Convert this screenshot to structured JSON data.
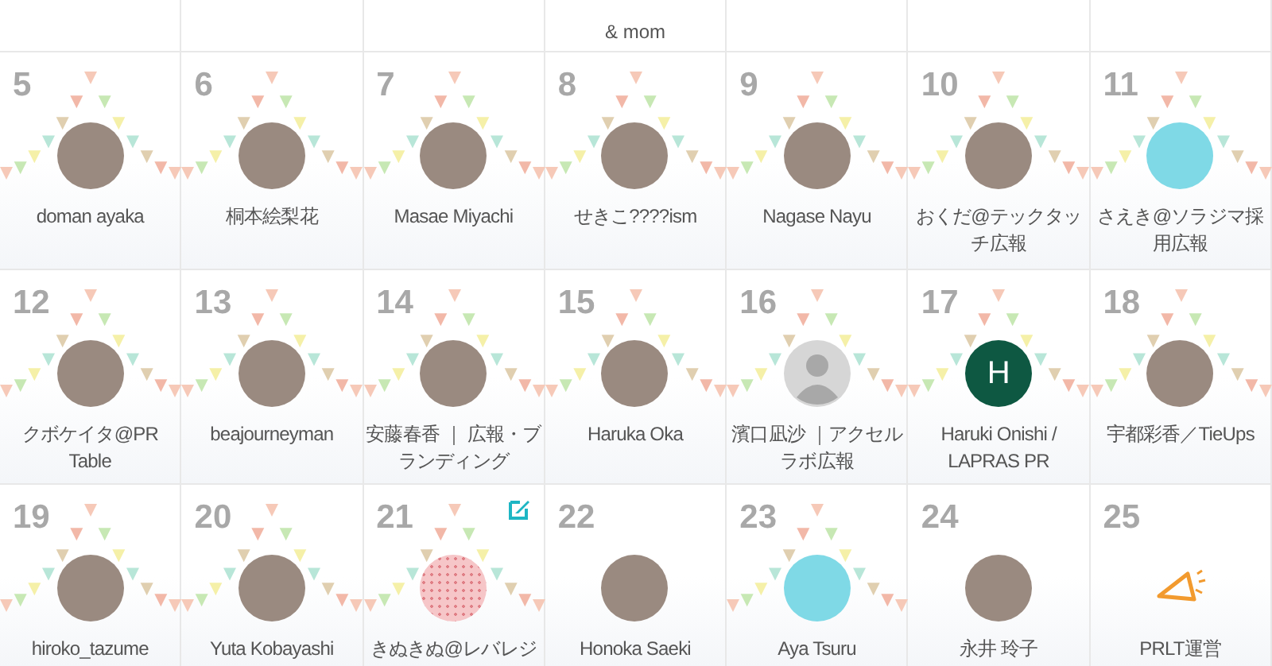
{
  "top_row": [
    {
      "kind": "blank"
    },
    {
      "kind": "blank"
    },
    {
      "kind": "blank"
    },
    {
      "kind": "name",
      "name": "& mom"
    },
    {
      "kind": "blank"
    },
    {
      "kind": "blank"
    },
    {
      "kind": "blank"
    }
  ],
  "days": [
    {
      "day": "5",
      "name": "doman ayaka",
      "kind": "photo",
      "decorated": true,
      "editable": false
    },
    {
      "day": "6",
      "name": "桐本絵梨花",
      "kind": "photo",
      "decorated": true,
      "editable": false
    },
    {
      "day": "7",
      "name": "Masae Miyachi",
      "kind": "photo",
      "decorated": true,
      "editable": false
    },
    {
      "day": "8",
      "name": "せきこ????ism",
      "kind": "photo",
      "decorated": true,
      "editable": false
    },
    {
      "day": "9",
      "name": "Nagase Nayu",
      "kind": "photo",
      "decorated": true,
      "editable": false
    },
    {
      "day": "10",
      "name": "おくだ@テックタッチ広報",
      "kind": "photo",
      "decorated": true,
      "editable": false
    },
    {
      "day": "11",
      "name": "さえき@ソラジマ採用広報",
      "kind": "illustration",
      "decorated": true,
      "editable": false
    },
    {
      "day": "12",
      "name": "クボケイタ@PR Table",
      "kind": "photo",
      "decorated": true,
      "editable": false
    },
    {
      "day": "13",
      "name": "beajourneyman",
      "kind": "photo",
      "decorated": true,
      "editable": false
    },
    {
      "day": "14",
      "name": "安藤春香 ｜ 広報・ブランディング",
      "kind": "photo",
      "decorated": true,
      "editable": false
    },
    {
      "day": "15",
      "name": "Haruka Oka",
      "kind": "photo",
      "decorated": true,
      "editable": false
    },
    {
      "day": "16",
      "name": "濱口凪沙 ｜アクセルラボ広報",
      "kind": "default",
      "decorated": true,
      "editable": false
    },
    {
      "day": "17",
      "name": "Haruki Onishi / LAPRAS PR",
      "kind": "initial",
      "initial": "H",
      "decorated": true,
      "editable": false
    },
    {
      "day": "18",
      "name": "宇都彩香／TieUps",
      "kind": "photo",
      "decorated": true,
      "editable": false
    },
    {
      "day": "19",
      "name": "hiroko_tazume",
      "kind": "photo",
      "decorated": true,
      "editable": false
    },
    {
      "day": "20",
      "name": "Yuta Kobayashi",
      "kind": "photo",
      "decorated": true,
      "editable": false
    },
    {
      "day": "21",
      "name": "きぬきぬ@レバレジ",
      "kind": "pattern",
      "decorated": true,
      "editable": true
    },
    {
      "day": "22",
      "name": "Honoka Saeki",
      "kind": "photo",
      "decorated": false,
      "editable": false
    },
    {
      "day": "23",
      "name": "Aya Tsuru",
      "kind": "illustration",
      "decorated": true,
      "editable": false
    },
    {
      "day": "24",
      "name": "永井 玲子",
      "kind": "photo",
      "decorated": false,
      "editable": false
    },
    {
      "day": "25",
      "name": "PRLT運営",
      "kind": "logo",
      "decorated": false,
      "editable": false
    }
  ]
}
